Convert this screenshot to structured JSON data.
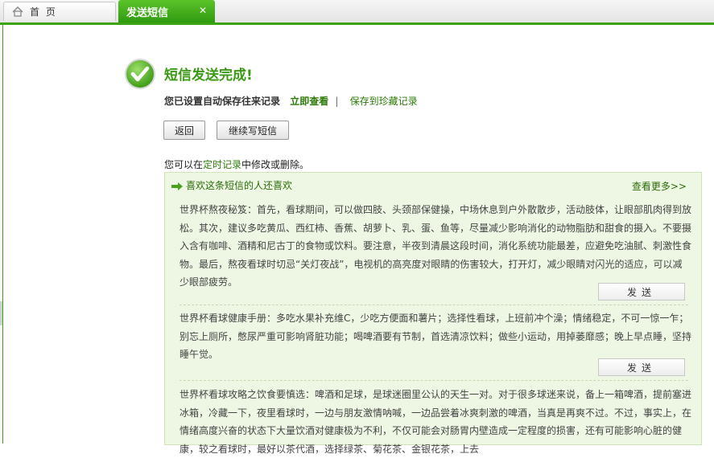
{
  "tabs": {
    "home_label": "首 页",
    "active_label": "发送短信",
    "close_glyph": "✕"
  },
  "result": {
    "title": "短信发送完成!",
    "auto_save_text": "您已设置自动保存往来记录",
    "view_now": "立即查看",
    "separator": "|",
    "save_fav": "保存到珍藏记录"
  },
  "buttons": {
    "back": "返回",
    "continue": "继续写短信"
  },
  "tip": {
    "prefix": "您可以在",
    "link": "定时记录",
    "suffix": "中修改或删除。"
  },
  "recommend": {
    "header": "喜欢这条短信的人还喜欢",
    "more": "查看更多>>",
    "send_label": "发送",
    "messages": [
      "世界杯熬夜秘笈：首先，看球期间，可以做四肢、头颈部保健操，中场休息到户外散散步，活动肢体，让眼部肌肉得到放松。其次，建议多吃黄瓜、西红柿、香蕉、胡萝卜、乳、蛋、鱼等，尽量减少影响消化的动物脂肪和甜食的摄入。不要摄入含有咖啡、酒精和尼古丁的食物或饮料。要注意，半夜到清晨这段时间，消化系统功能最差，应避免吃油腻、刺激性食物。最后，熬夜看球时切忌“关灯夜战”，电视机的高亮度对眼睛的伤害较大，打开灯，减少眼睛对闪光的适应，可以减少眼部疲劳。",
      "世界杯看球健康手册：多吃水果补充维C，少吃方便面和薯片；选择性看球，上班前冲个澡；情绪稳定，不可一惊一乍；别忘上厕所，憋尿严重可影响肾脏功能；喝啤酒要有节制，首选清凉饮料；做些小运动，用掉萎靡感；晚上早点睡，坚持睡午觉。",
      "世界杯看球攻略之饮食要慎选：啤酒和足球，是球迷圈里公认的天生一对。对于很多球迷来说，备上一箱啤酒，提前塞进冰箱，冷藏一下，夜里看球时，一边与朋友激情呐喊，一边品尝着冰爽刺激的啤酒，当真是再爽不过。不过，事实上，在情绪高度兴奋的状态下大量饮酒对健康极为不利，不仅可能会对肠胃内壁造成一定程度的损害，还有可能影响心脏的健康，较之看球时，最好以茶代酒，选择绿茶、菊花茶、金银花茶，上去"
    ]
  },
  "colors": {
    "accent": "#3aa414",
    "tab_active": "#3fa818",
    "panel_bg": "#eef7e4",
    "link": "#2c7a07"
  }
}
